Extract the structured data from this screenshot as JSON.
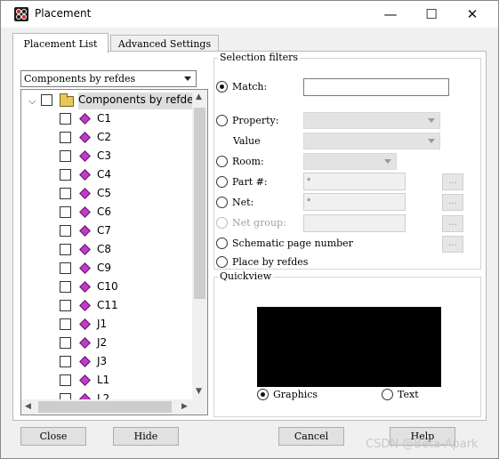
{
  "window": {
    "title": "Placement",
    "controls": {
      "minimize": "—",
      "maximize": "☐",
      "close": "✕"
    }
  },
  "tabs": [
    {
      "label": "Placement List",
      "active": true
    },
    {
      "label": "Advanced Settings",
      "active": false
    }
  ],
  "list_view": {
    "selected": "Components by refdes"
  },
  "tree": {
    "root_label": "Components by refde",
    "items": [
      "C1",
      "C2",
      "C3",
      "C4",
      "C5",
      "C6",
      "C7",
      "C8",
      "C9",
      "C10",
      "C11",
      "J1",
      "J2",
      "J3",
      "L1",
      "L2"
    ]
  },
  "selection_filters": {
    "title": "Selection filters",
    "match": {
      "label": "Match:",
      "value": "",
      "selected": true
    },
    "property": {
      "label": "Property:",
      "value_label": "Value"
    },
    "room": {
      "label": "Room:"
    },
    "part": {
      "label": "Part #:",
      "value": "*"
    },
    "net": {
      "label": "Net:",
      "value": "*"
    },
    "net_group": {
      "label": "Net group:",
      "value": ""
    },
    "schematic_page": {
      "label": "Schematic page number"
    },
    "place_by_refdes": {
      "label": "Place by refdes"
    },
    "browse_label": "..."
  },
  "quickview": {
    "title": "Quickview",
    "graphics_label": "Graphics",
    "text_label": "Text",
    "selected": "Graphics"
  },
  "buttons": {
    "close": "Close",
    "hide": "Hide",
    "cancel": "Cancel",
    "help": "Help"
  },
  "watermark": "CSDN @Beta-Apark",
  "colors": {
    "component_icon": "#c23ac8",
    "folder_icon": "#e8c85a"
  }
}
